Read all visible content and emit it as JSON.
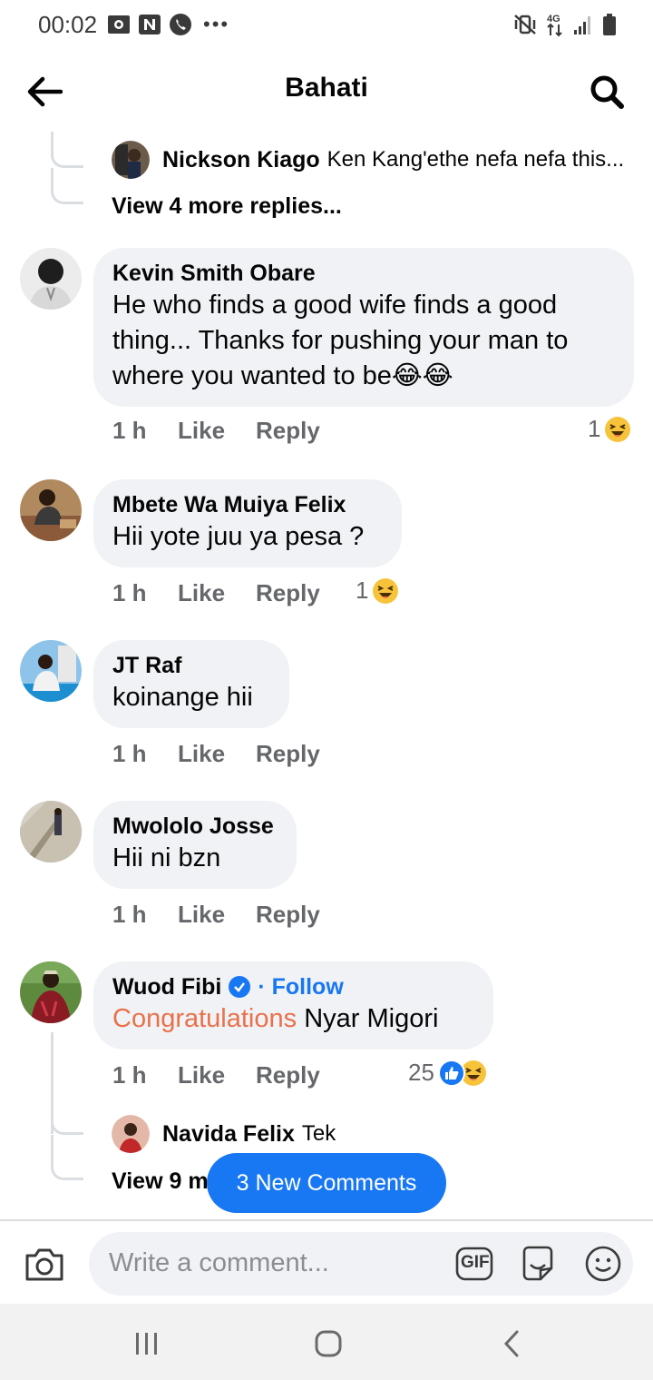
{
  "status_bar": {
    "time": "00:02",
    "network": "4G",
    "icons_left": [
      "screen-record-icon",
      "n-app-icon",
      "phone-icon"
    ],
    "icons_right": [
      "mute-vibrate-icon",
      "data-arrows-icon",
      "signal-icon",
      "battery-icon"
    ]
  },
  "header": {
    "title": "Bahati"
  },
  "top_reply": {
    "name": "Nickson Kiago",
    "text": "Ken Kang'ethe  nefa nefa this..."
  },
  "top_view_more": "View 4 more replies...",
  "comments": [
    {
      "name": "Kevin Smith Obare",
      "text": "He who finds a good wife finds a good thing... Thanks for pushing your man to where you wanted to be😂😂",
      "time": "1 h",
      "like": "Like",
      "reply": "Reply",
      "reaction_count": "1",
      "reactions": [
        "haha"
      ]
    },
    {
      "name": "Mbete Wa Muiya Felix",
      "text": "Hii yote juu ya pesa ?",
      "time": "1 h",
      "like": "Like",
      "reply": "Reply",
      "reaction_count": "1",
      "reactions": [
        "haha"
      ]
    },
    {
      "name": "JT Raf",
      "text": "koinange hii",
      "time": "1 h",
      "like": "Like",
      "reply": "Reply"
    },
    {
      "name": "Mwololo Josse",
      "text": "Hii ni bzn",
      "time": "1 h",
      "like": "Like",
      "reply": "Reply"
    },
    {
      "name": "Wuod Fibi",
      "follow": "· Follow",
      "text_highlight": "Congratulations",
      "text": " Nyar Migori",
      "time": "1 h",
      "like": "Like",
      "reply": "Reply",
      "reaction_count": "25",
      "reactions": [
        "like",
        "haha"
      ]
    }
  ],
  "bottom_reply": {
    "name": "Navida Felix",
    "text": "Tek"
  },
  "bottom_view_more": "View 9 m",
  "new_comments_pill": "3 New Comments",
  "composer": {
    "placeholder": "Write a comment...",
    "gif_label": "GIF"
  },
  "colors": {
    "accent": "#1877f2",
    "highlight": "#e9714a",
    "bubble": "#f0f2f5",
    "meta": "#65676b"
  }
}
